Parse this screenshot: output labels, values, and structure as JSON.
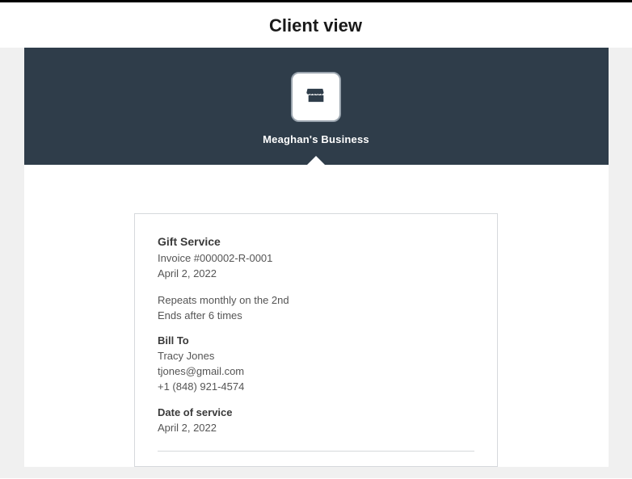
{
  "header": {
    "title": "Client view"
  },
  "business": {
    "name": "Meaghan's Business"
  },
  "invoice": {
    "service_title": "Gift Service",
    "invoice_number": "Invoice #000002-R-0001",
    "invoice_date": "April 2, 2022",
    "repeat_rule": "Repeats monthly on the 2nd",
    "end_rule": "Ends after 6 times",
    "bill_to_label": "Bill To",
    "bill_to_name": "Tracy Jones",
    "bill_to_email": "tjones@gmail.com",
    "bill_to_phone": "+1 (848) 921-4574",
    "service_date_label": "Date of service",
    "service_date": "April 2, 2022"
  }
}
